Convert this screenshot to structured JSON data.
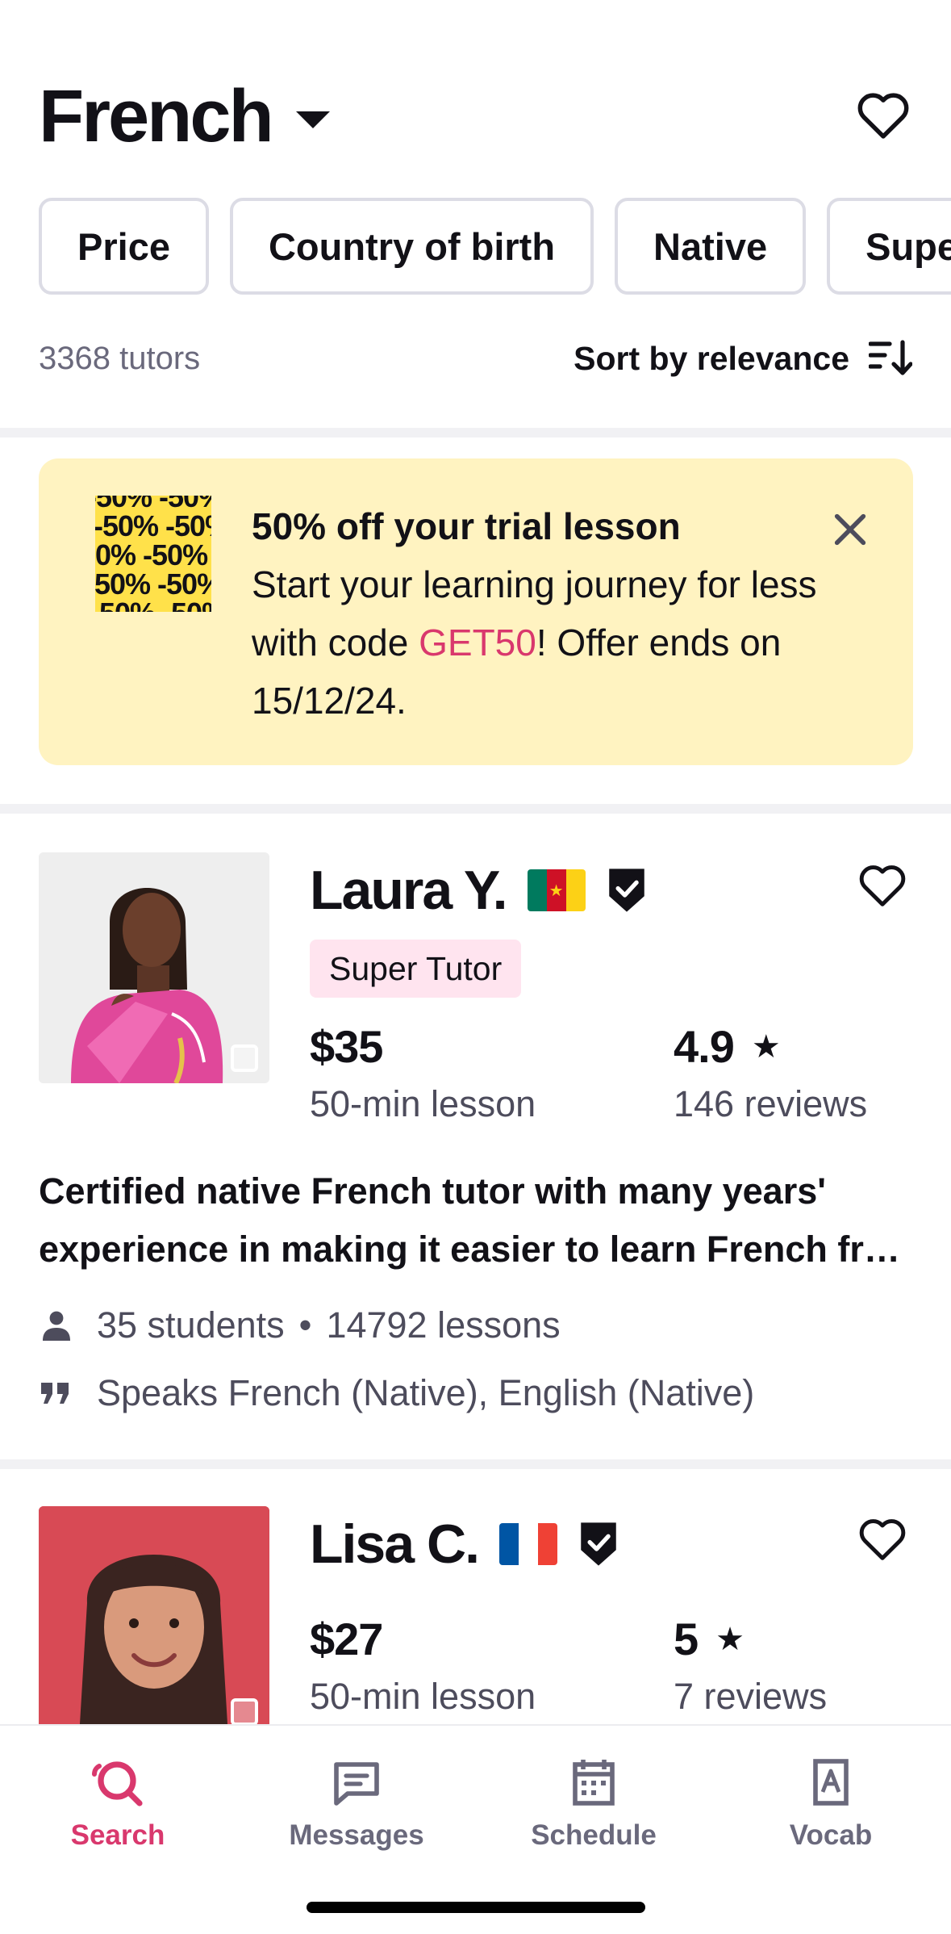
{
  "header": {
    "title": "French",
    "filters": [
      "Price",
      "Country of birth",
      "Native",
      "Supe"
    ],
    "tutor_count": "3368 tutors",
    "sort_label": "Sort by relevance"
  },
  "promo": {
    "image_text": "-50% -50% -50%",
    "title": "50% off your trial lesson",
    "body_before": "Start your learning journey for less with code ",
    "code": "GET50",
    "body_after": "! Offer ends on 15/12/24."
  },
  "tutors": [
    {
      "name": "Laura Y.",
      "flag_colors": [
        "#007a5e",
        "#ce1126",
        "#fcd116"
      ],
      "badge": "Super Tutor",
      "price": "$35",
      "price_sub": "50-min lesson",
      "rating": "4.9",
      "reviews": "146 reviews",
      "description": "Certified native French tutor with many years' experience in making it easier to learn French fr…",
      "students": "35 students",
      "lessons": "14792 lessons",
      "speaks": "Speaks French (Native), English (Native)"
    },
    {
      "name": "Lisa C.",
      "flag_colors": [
        "#0055a4",
        "#ffffff",
        "#ef4135"
      ],
      "price": "$27",
      "price_sub": "50-min lesson",
      "rating": "5",
      "reviews": "7 reviews"
    }
  ],
  "tabs": [
    {
      "label": "Search",
      "icon": "search-icon",
      "active": true
    },
    {
      "label": "Messages",
      "icon": "message-icon",
      "active": false
    },
    {
      "label": "Schedule",
      "icon": "calendar-icon",
      "active": false
    },
    {
      "label": "Vocab",
      "icon": "vocab-icon",
      "active": false
    }
  ],
  "colors": {
    "accent": "#d9386d",
    "promo_bg": "#fff3c1",
    "super_tutor_bg": "#ffe4ef",
    "muted_text": "#6a697c"
  }
}
